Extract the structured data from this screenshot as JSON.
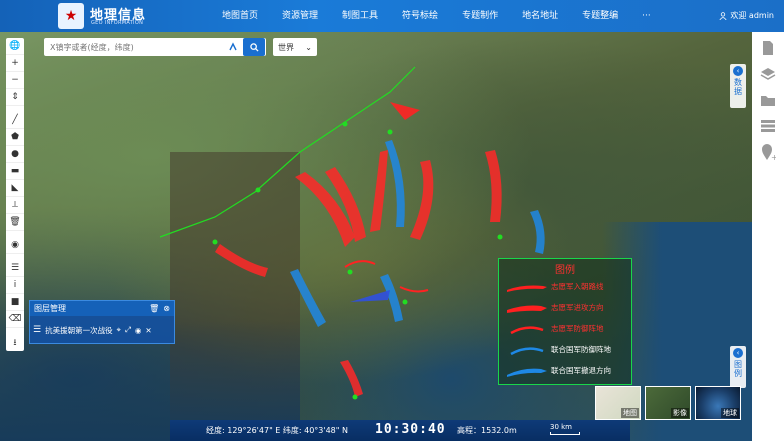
{
  "app": {
    "title": "地理信息",
    "subtitle": "GEO INFORMATION"
  },
  "nav": {
    "items": [
      {
        "label": "地图首页"
      },
      {
        "label": "资源管理"
      },
      {
        "label": "制图工具"
      },
      {
        "label": "符号标绘"
      },
      {
        "label": "专题制作"
      },
      {
        "label": "地名地址"
      },
      {
        "label": "专题整编"
      },
      {
        "label": "···"
      }
    ]
  },
  "user": {
    "greeting": "欢迎 admin"
  },
  "search": {
    "placeholder": "X镇字或者(经度，纬度)",
    "region_select": "世界"
  },
  "toolbar": {
    "tools": [
      "globe-icon",
      "zoom-in-icon",
      "zoom-out-icon",
      "compass-icon",
      "line-icon",
      "polygon-icon",
      "marker-icon",
      "rectangle-icon",
      "measure-area-icon",
      "ruler-icon",
      "delete-icon",
      "locate-icon",
      "layers-icon",
      "info-icon",
      "stop-icon",
      "trash-icon",
      "export-icon"
    ]
  },
  "layer_panel": {
    "title": "图层管理",
    "layer_name": "抗美援朝第一次战役"
  },
  "side_tabs": {
    "data": "数据",
    "legend": "图例"
  },
  "legend": {
    "title": "图例",
    "items": [
      {
        "label": "志愿军入朝路线",
        "color": "#ff2020"
      },
      {
        "label": "志愿军进攻方向",
        "color": "#ff2020"
      },
      {
        "label": "志愿军防御阵地",
        "color": "#ff2020"
      },
      {
        "label": "联合国军防御阵地",
        "color": "#1e88e5"
      },
      {
        "label": "联合国军撤退方向",
        "color": "#1e88e5"
      }
    ]
  },
  "basemaps": [
    {
      "label": "地图"
    },
    {
      "label": "影像"
    },
    {
      "label": "地球"
    }
  ],
  "status": {
    "longitude": "经度: 129°26'47\" E",
    "latitude": "纬度: 40°3'48\" N",
    "clock": "10:30:40",
    "altitude": "高程：1532.0m",
    "scale": "30 km"
  },
  "colors": {
    "header": "#1a7bd8",
    "attack": "#ff2020",
    "retreat": "#1e88e5",
    "route": "#22dd22",
    "legend_border": "#19d64a"
  }
}
